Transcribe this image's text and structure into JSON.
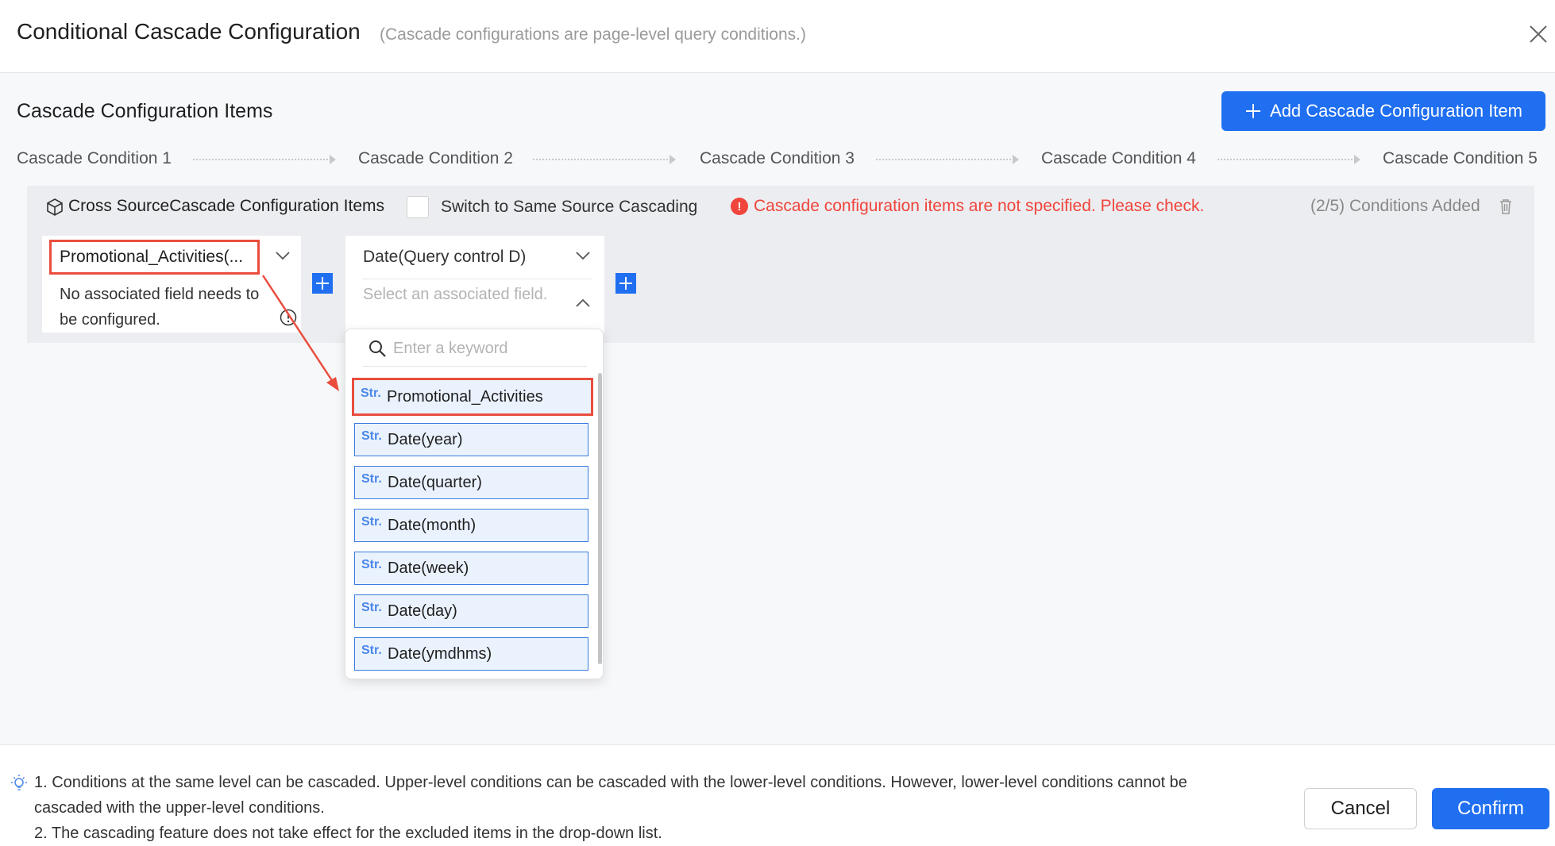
{
  "header": {
    "title": "Conditional Cascade Configuration",
    "subtitle": "(Cascade configurations are page-level query conditions.)",
    "close_icon": "close-icon"
  },
  "section": {
    "title": "Cascade Configuration Items",
    "add_button": "Add Cascade Configuration Item"
  },
  "steps": [
    "Cascade Condition 1",
    "Cascade Condition 2",
    "Cascade Condition 3",
    "Cascade Condition 4",
    "Cascade Condition 5"
  ],
  "panel": {
    "title": "Cross SourceCascade Configuration Items",
    "switch_label": "Switch to Same Source Cascading",
    "error": "Cascade configuration items are not specified. Please check.",
    "count": "(2/5) Conditions Added"
  },
  "condition1": {
    "selected": "Promotional_Activities(...",
    "note": "No associated field needs to be configured."
  },
  "condition2": {
    "selected": "Date(Query control D)",
    "field_placeholder": "Select an associated field."
  },
  "dropdown": {
    "search_placeholder": "Enter a keyword",
    "options": [
      {
        "type": "Str.",
        "label": "Promotional_Activities"
      },
      {
        "type": "Str.",
        "label": "Date(year)"
      },
      {
        "type": "Str.",
        "label": "Date(quarter)"
      },
      {
        "type": "Str.",
        "label": "Date(month)"
      },
      {
        "type": "Str.",
        "label": "Date(week)"
      },
      {
        "type": "Str.",
        "label": "Date(day)"
      },
      {
        "type": "Str.",
        "label": "Date(ymdhms)"
      }
    ]
  },
  "footer": {
    "tip1_line1": "1. Conditions at the same level can be cascaded. Upper-level conditions can be cascaded with the lower-level conditions. However, lower-level conditions cannot be",
    "tip1_line2": "cascaded with the upper-level conditions.",
    "tip2": "2. The cascading feature does not take effect for the excluded items in the drop-down list.",
    "cancel": "Cancel",
    "confirm": "Confirm"
  },
  "colors": {
    "accent": "#1f6ff0",
    "error": "#f0443c",
    "highlight_box": "#ea4d3d",
    "option_bg": "#eaf2fe"
  }
}
